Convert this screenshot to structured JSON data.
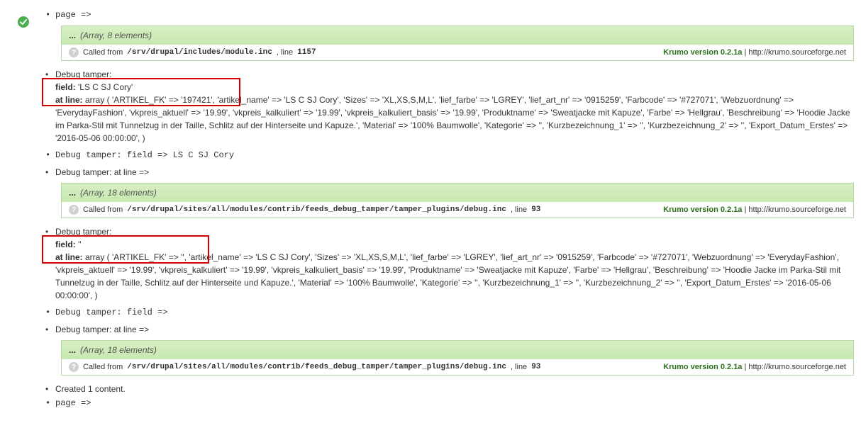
{
  "items": {
    "page_label": "page =>",
    "created_content": "Created 1 content.",
    "page_label2": "page =>"
  },
  "krumo1": {
    "label": "...",
    "meta": "(Array, 8 elements)",
    "called_from": "Called from ",
    "path": "/srv/drupal/includes/module.inc",
    "line_text": ", line ",
    "line_num": "1157",
    "version": "Krumo version 0.2.1a",
    "sep": " | ",
    "link": "http://krumo.sourceforge.net"
  },
  "block1": {
    "title": "Debug tamper:",
    "field_label": "field:",
    "field_value": " 'LS C SJ Cory'",
    "atline_label": "at line:",
    "atline_value": " array ( 'ARTIKEL_FK' => '197421',",
    "rest": " 'artikel_name' => 'LS C SJ Cory', 'Sizes' => 'XL,XS,S,M,L', 'lief_farbe' => 'LGREY', 'lief_art_nr' => '0915259', 'Farbcode' => '#727071', 'Webzuordnung' => 'EverydayFashion', 'vkpreis_aktuell' => '19.99', 'vkpreis_kalkuliert' => '19.99', 'vkpreis_kalkuliert_basis' => '19.99', 'Produktname' => 'Sweatjacke mit Kapuze', 'Farbe' => 'Hellgrau', 'Beschreibung' => 'Hoodie Jacke im Parka-Stil mit Tunnelzug in der Taille, Schlitz auf der Hinterseite und Kapuze.', 'Material' => '100% Baumwolle', 'Kategorie' => '', 'Kurzbezeichnung_1' => '', 'Kurzbezeichnung_2' => '', 'Export_Datum_Erstes' => '2016-05-06 00:00:00', )"
  },
  "line_field1": "Debug tamper: field => LS C SJ Cory",
  "line_atline1": "Debug tamper: at line =>",
  "krumo2": {
    "label": "...",
    "meta": "(Array, 18 elements)",
    "called_from": "Called from ",
    "path": "/srv/drupal/sites/all/modules/contrib/feeds_debug_tamper/tamper_plugins/debug.inc",
    "line_text": ", line ",
    "line_num": "93",
    "version": "Krumo version 0.2.1a",
    "sep": " | ",
    "link": "http://krumo.sourceforge.net"
  },
  "block2": {
    "title": "Debug tamper:",
    "field_label": "field:",
    "field_value": " ''",
    "atline_label": "at line:",
    "atline_value": " array ( 'ARTIKEL_FK' => '',",
    "rest": " 'artikel_name' => 'LS C SJ Cory', 'Sizes' => 'XL,XS,S,M,L', 'lief_farbe' => 'LGREY', 'lief_art_nr' => '0915259', 'Farbcode' => '#727071', 'Webzuordnung' => 'EverydayFashion', 'vkpreis_aktuell' => '19.99', 'vkpreis_kalkuliert' => '19.99', 'vkpreis_kalkuliert_basis' => '19.99', 'Produktname' => 'Sweatjacke mit Kapuze', 'Farbe' => 'Hellgrau', 'Beschreibung' => 'Hoodie Jacke im Parka-Stil mit Tunnelzug in der Taille, Schlitz auf der Hinterseite und Kapuze.', 'Material' => '100% Baumwolle', 'Kategorie' => '', 'Kurzbezeichnung_1' => '', 'Kurzbezeichnung_2' => '', 'Export_Datum_Erstes' => '2016-05-06 00:00:00', )"
  },
  "line_field2": "Debug tamper: field =>",
  "line_atline2": "Debug tamper: at line =>",
  "krumo3": {
    "label": "...",
    "meta": "(Array, 18 elements)",
    "called_from": "Called from ",
    "path": "/srv/drupal/sites/all/modules/contrib/feeds_debug_tamper/tamper_plugins/debug.inc",
    "line_text": ", line ",
    "line_num": "93",
    "version": "Krumo version 0.2.1a",
    "sep": " | ",
    "link": "http://krumo.sourceforge.net"
  }
}
